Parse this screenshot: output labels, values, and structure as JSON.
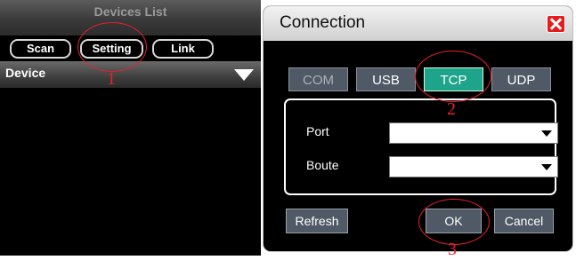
{
  "devices_panel": {
    "title": "Devices List",
    "buttons": [
      "Scan",
      "Setting",
      "Link"
    ],
    "device_label": "Device"
  },
  "dialog": {
    "title": "Connection",
    "tabs": [
      {
        "label": "COM",
        "state": "disabled"
      },
      {
        "label": "USB",
        "state": "normal"
      },
      {
        "label": "TCP",
        "state": "selected"
      },
      {
        "label": "UDP",
        "state": "normal"
      }
    ],
    "fields": [
      {
        "label": "Port",
        "value": ""
      },
      {
        "label": "Boute",
        "value": ""
      }
    ],
    "refresh_label": "Refresh",
    "ok_label": "OK",
    "cancel_label": "Cancel"
  },
  "annotations": [
    "1",
    "2",
    "3"
  ],
  "colors": {
    "selected_tab": "#1ea48a",
    "button_bg": "#4f5a66",
    "close_button": "#e41c1c",
    "annotation": "#e8202a"
  }
}
